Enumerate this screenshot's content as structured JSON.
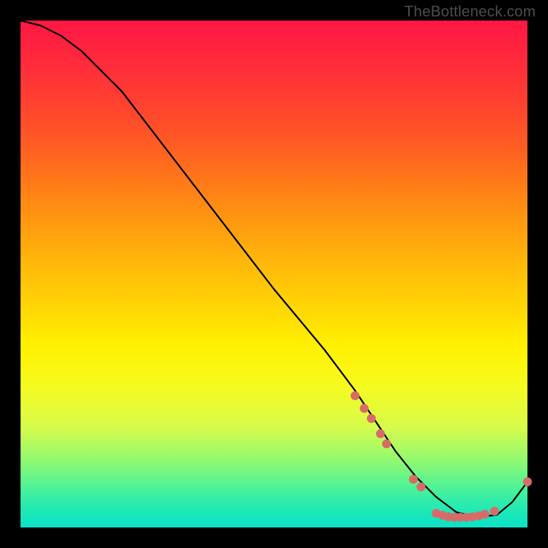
{
  "watermark": "TheBottleneck.com",
  "chart_data": {
    "type": "line",
    "title": "",
    "xlabel": "",
    "ylabel": "",
    "xlim": [
      0,
      100
    ],
    "ylim": [
      0,
      100
    ],
    "grid": false,
    "series": [
      {
        "name": "curve",
        "x": [
          0,
          4,
          8,
          12,
          20,
          30,
          40,
          50,
          60,
          66,
          70,
          74,
          78,
          82,
          86,
          90,
          94,
          97,
          100
        ],
        "y": [
          100,
          99,
          97,
          94,
          86,
          73,
          60,
          47,
          35,
          27,
          21,
          15,
          10,
          6,
          3,
          2,
          2.5,
          5,
          9
        ]
      }
    ],
    "markers": [
      {
        "x": 66.0,
        "y": 26.0
      },
      {
        "x": 67.8,
        "y": 23.5
      },
      {
        "x": 69.2,
        "y": 21.5
      },
      {
        "x": 71.0,
        "y": 18.5
      },
      {
        "x": 72.2,
        "y": 16.5
      },
      {
        "x": 77.5,
        "y": 9.5
      },
      {
        "x": 79.0,
        "y": 8.0
      },
      {
        "x": 82.0,
        "y": 2.8
      },
      {
        "x": 83.2,
        "y": 2.4
      },
      {
        "x": 84.4,
        "y": 2.1
      },
      {
        "x": 85.6,
        "y": 2.0
      },
      {
        "x": 86.8,
        "y": 2.0
      },
      {
        "x": 88.0,
        "y": 2.0
      },
      {
        "x": 89.2,
        "y": 2.1
      },
      {
        "x": 90.4,
        "y": 2.3
      },
      {
        "x": 91.6,
        "y": 2.6
      },
      {
        "x": 93.5,
        "y": 3.2
      },
      {
        "x": 100.0,
        "y": 9.0
      }
    ]
  }
}
